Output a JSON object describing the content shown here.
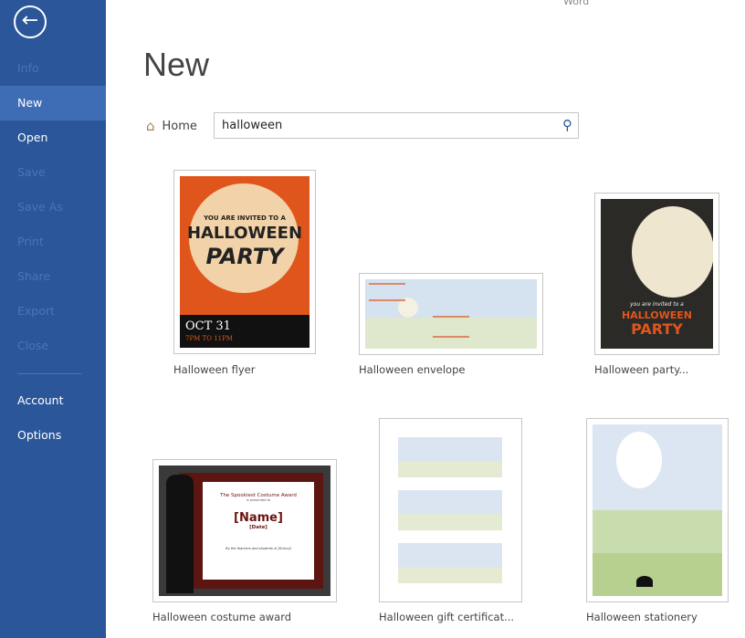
{
  "app": {
    "name": "Word"
  },
  "sidebar": {
    "items": [
      {
        "label": "Info",
        "state": "disabled"
      },
      {
        "label": "New",
        "state": "selected"
      },
      {
        "label": "Open",
        "state": "enabled"
      },
      {
        "label": "Save",
        "state": "disabled"
      },
      {
        "label": "Save As",
        "state": "disabled"
      },
      {
        "label": "Print",
        "state": "disabled"
      },
      {
        "label": "Share",
        "state": "disabled"
      },
      {
        "label": "Export",
        "state": "disabled"
      },
      {
        "label": "Close",
        "state": "disabled"
      },
      {
        "label": "Account",
        "state": "enabled"
      },
      {
        "label": "Options",
        "state": "enabled"
      }
    ],
    "back_icon": "back-arrow-icon",
    "color": "#2b579a"
  },
  "main": {
    "title": "New",
    "home_label": "Home",
    "search": {
      "value": "halloween",
      "icon": "search-icon"
    }
  },
  "templates": [
    {
      "label": "Halloween flyer",
      "lines": [
        "YOU ARE INVITED TO A",
        "HALLOWEEN",
        "PARTY",
        "OCT 31",
        "7PM TO 11PM"
      ]
    },
    {
      "label": "Halloween envelope"
    },
    {
      "label": "Halloween party...",
      "lines": [
        "you are invited to a",
        "HALLOWEEN",
        "PARTY"
      ]
    },
    {
      "label": "Halloween costume award",
      "lines": [
        "The Spookiest Costume Award",
        "is presented to",
        "[Name]",
        "[Date]",
        "By the teachers and students of [School]"
      ]
    },
    {
      "label": "Halloween gift certificat..."
    },
    {
      "label": "Halloween stationery"
    }
  ]
}
